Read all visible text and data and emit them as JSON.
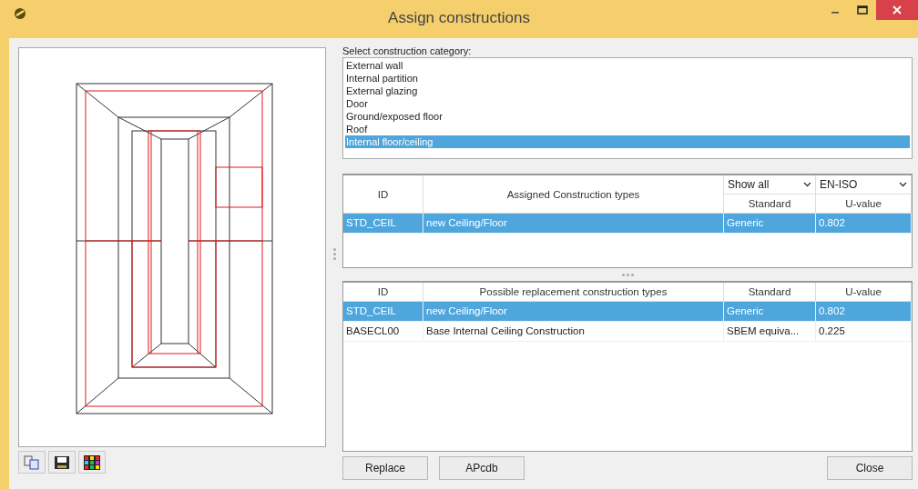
{
  "window": {
    "title": "Assign constructions"
  },
  "category": {
    "label": "Select construction category:",
    "items": [
      {
        "label": "External wall",
        "selected": false
      },
      {
        "label": "Internal partition",
        "selected": false
      },
      {
        "label": "External glazing",
        "selected": false
      },
      {
        "label": "Door",
        "selected": false
      },
      {
        "label": "Ground/exposed floor",
        "selected": false
      },
      {
        "label": "Roof",
        "selected": false
      },
      {
        "label": "Internal floor/ceiling",
        "selected": true
      }
    ]
  },
  "assigned": {
    "columns": [
      "ID",
      "Assigned Construction types",
      "Standard",
      "U-value"
    ],
    "filters": [
      "Show all",
      "EN-ISO"
    ],
    "rows": [
      {
        "cells": [
          "STD_CEIL",
          "new Ceiling/Floor",
          "Generic",
          "0.802"
        ],
        "selected": true
      }
    ]
  },
  "replacement": {
    "columns": [
      "ID",
      "Possible replacement construction types",
      "Standard",
      "U-value"
    ],
    "rows": [
      {
        "cells": [
          "STD_CEIL",
          "new Ceiling/Floor",
          "Generic",
          "0.802"
        ],
        "selected": true
      },
      {
        "cells": [
          "BASECL00",
          "Base Internal Ceiling Construction",
          "SBEM equiva...",
          "0.225"
        ],
        "selected": false
      }
    ]
  },
  "buttons": [
    {
      "label": "Replace",
      "kind": "left"
    },
    {
      "label": "APcdb",
      "kind": "left"
    },
    {
      "label": "Close",
      "kind": "right"
    }
  ]
}
